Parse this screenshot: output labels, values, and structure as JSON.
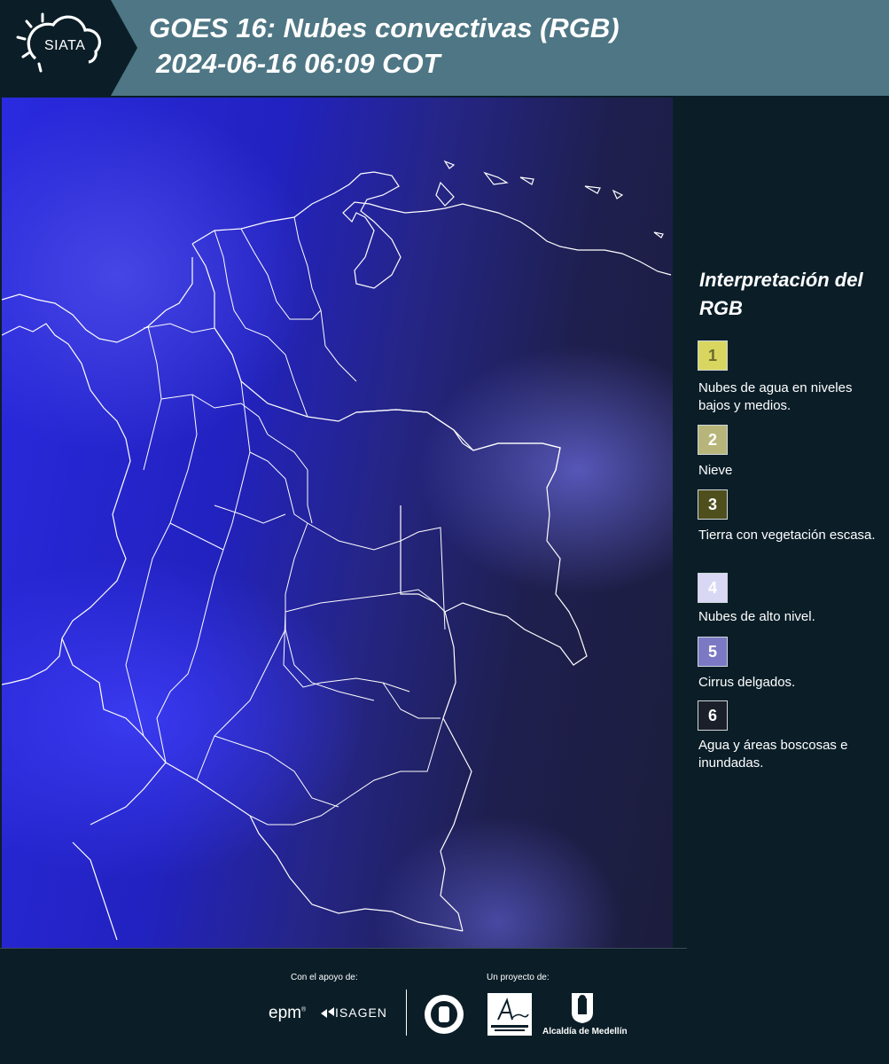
{
  "header": {
    "logo_text": "SIATA",
    "title_line1": "GOES 16: Nubes convectivas (RGB)",
    "title_line2": "2024-06-16 06:09 COT"
  },
  "legend": {
    "title": "Interpretación del RGB",
    "items": [
      {
        "number": "1",
        "label": "Nubes de agua en niveles bajos y medios.",
        "color": "#d9d660",
        "text_color": "#6b6a2a"
      },
      {
        "number": "2",
        "label": "Nieve",
        "color": "#b7b57a",
        "text_color": "#ffffff"
      },
      {
        "number": "3",
        "label": "Tierra con vegetación escasa.",
        "color": "#4f4f1e",
        "text_color": "#ffffff"
      },
      {
        "number": "4",
        "label": "Nubes de alto nivel.",
        "color": "#d8d8f4",
        "text_color": "#ffffff"
      },
      {
        "number": "5",
        "label": "Cirrus delgados.",
        "color": "#7b79c4",
        "text_color": "#ffffff"
      },
      {
        "number": "6",
        "label": "Agua y áreas boscosas e inundadas.",
        "color": "#1a1f2a",
        "text_color": "#ffffff"
      }
    ]
  },
  "footer": {
    "support_label": "Con el apoyo de:",
    "project_label": "Un proyecto de:",
    "sponsors": [
      "epm",
      "ISAGEN"
    ],
    "partners": [
      "Área Metropolitana Valle de Aburrá",
      "Alcaldía de Medellín"
    ],
    "alcaldia_text": "Alcaldía de Medellín"
  }
}
